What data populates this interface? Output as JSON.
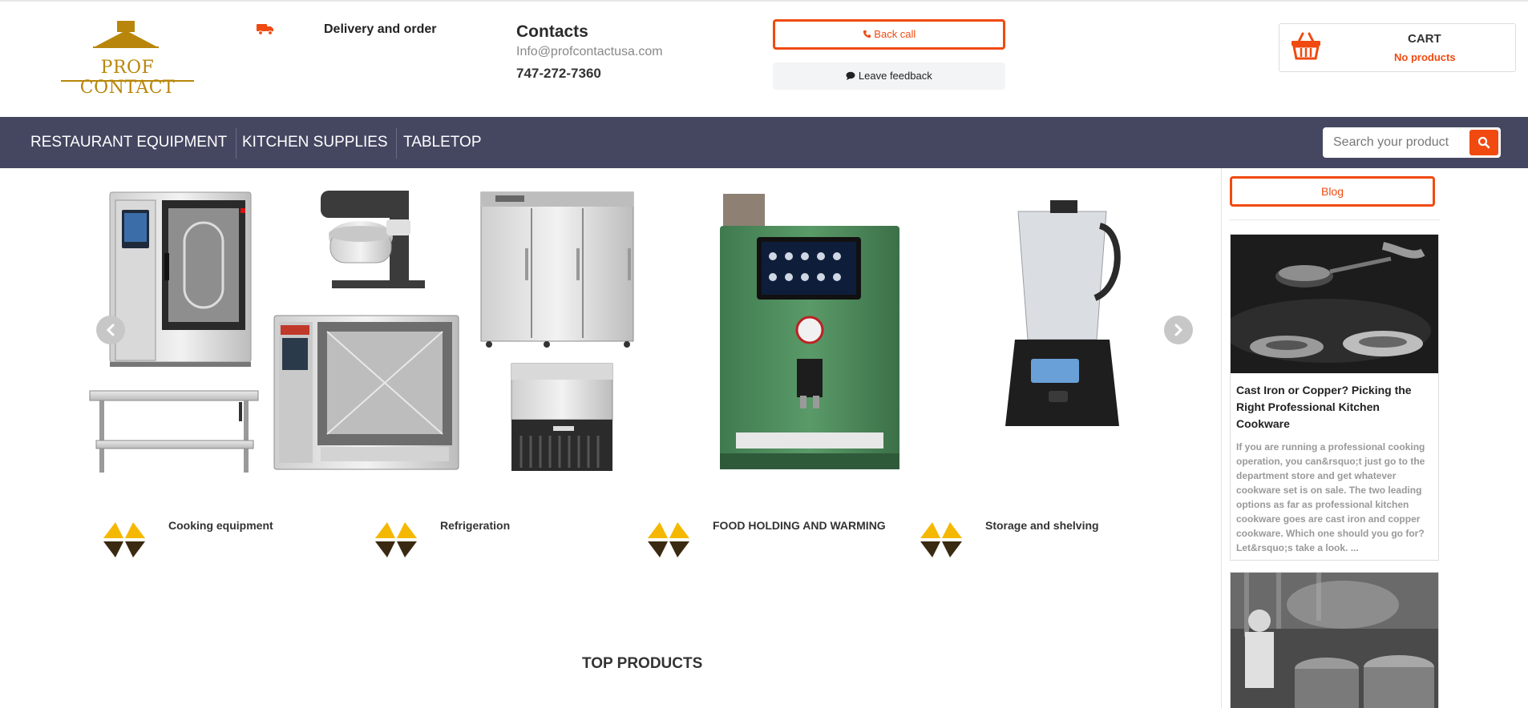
{
  "header": {
    "logo_text": "PROF CONTACT",
    "delivery_label": "Delivery and order",
    "contacts": {
      "title": "Contacts",
      "email": "Info@profcontactusa.com",
      "phone": "747-272-7360"
    },
    "back_call_label": "Back call",
    "feedback_label": "Leave feedback",
    "cart": {
      "title": "CART",
      "status": "No products"
    }
  },
  "nav": {
    "items": [
      {
        "label": "RESTAURANT EQUIPMENT"
      },
      {
        "label": "KITCHEN SUPPLIES"
      },
      {
        "label": "TABLETOP"
      }
    ],
    "search": {
      "placeholder": "Search your product"
    }
  },
  "carousel": {
    "products": [
      "combi-oven",
      "stand-mixer",
      "work-table",
      "combi-oven-2",
      "reach-in-refrigerator",
      "ice-machine",
      "coffee-machine",
      "blender"
    ]
  },
  "categories": [
    {
      "label": "Cooking equipment"
    },
    {
      "label": "Refrigeration"
    },
    {
      "label": "FOOD HOLDING AND WARMING"
    },
    {
      "label": "Storage and shelving"
    }
  ],
  "section_title": "TOP PRODUCTS",
  "sidebar": {
    "blog_button_label": "Blog",
    "posts": [
      {
        "title": "Cast Iron or Copper? Picking the Right Professional Kitchen Cookware",
        "excerpt": "If you are running a professional cooking operation, you can&rsquo;t just go to the department store and get whatever cookware set is on sale. The two leading options as far as professional kitchen cookware goes are cast iron and copper cookware. Which one should you go for? Let&rsquo;s take a look. ..."
      }
    ]
  },
  "colors": {
    "accent": "#f04a10",
    "nav_bg": "#454761",
    "logo_gold": "#b8860b",
    "category_icon_yellow": "#f5b800",
    "category_icon_dark": "#3a2a12"
  },
  "icons": {
    "delivery": "truck-icon",
    "back_call": "phone-icon",
    "feedback": "comment-icon",
    "cart": "basket-icon",
    "search": "search-icon",
    "carousel_prev": "chevron-left-icon",
    "carousel_next": "chevron-right-icon"
  }
}
